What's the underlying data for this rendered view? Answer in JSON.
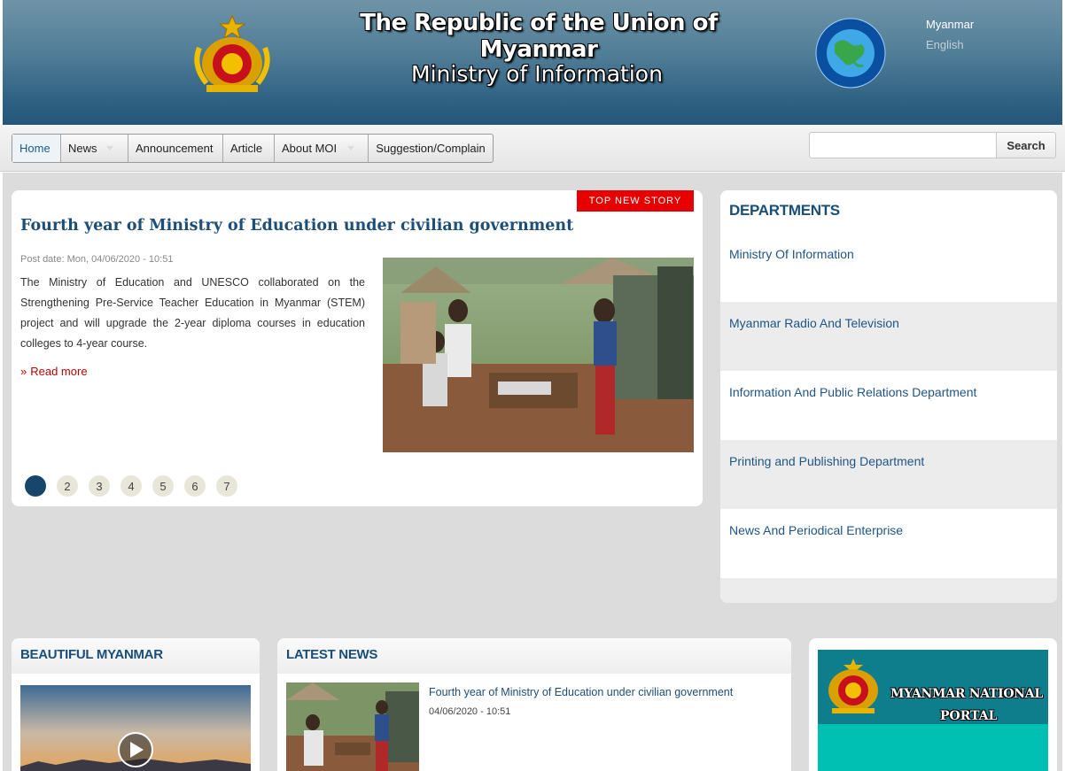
{
  "header": {
    "title_line1": "The Republic of the Union of Myanmar",
    "title_line2": "Ministry of Information",
    "languages": [
      "Myanmar",
      "English"
    ]
  },
  "nav": {
    "items": [
      {
        "label": "Home",
        "active": true,
        "has_dropdown": false
      },
      {
        "label": "News",
        "active": false,
        "has_dropdown": true
      },
      {
        "label": "Announcement",
        "active": false,
        "has_dropdown": false
      },
      {
        "label": "Article",
        "active": false,
        "has_dropdown": false
      },
      {
        "label": "About MOI",
        "active": false,
        "has_dropdown": true
      },
      {
        "label": "Suggestion/Complain",
        "active": false,
        "has_dropdown": false
      }
    ],
    "search": {
      "value": "",
      "button_label": "Search"
    }
  },
  "top_story": {
    "badge": "TOP NEW STORY",
    "title": "Fourth year of Ministry of Education under civilian government",
    "post_date": "Post date: Mon, 04/06/2020 - 10:51",
    "body": "The Ministry of Education and UNESCO collaborated on the Strengthening Pre-Service Teacher Education in Myanmar (STEM) project and will upgrade the 2-year diploma courses in education colleges to 4-year course.",
    "read_more": "Read more",
    "pager": {
      "active": 1,
      "pages": [
        "",
        "2",
        "3",
        "4",
        "5",
        "6",
        "7"
      ]
    }
  },
  "departments": {
    "title": "DEPARTMENTS",
    "items": [
      "Ministry Of Information",
      "Myanmar Radio And Television",
      "Information And Public Relations Department",
      "Printing and Publishing Department",
      "News And Periodical Enterprise"
    ]
  },
  "beautiful_myanmar": {
    "title": "BEAUTIFUL MYANMAR"
  },
  "latest_news": {
    "title": "LATEST NEWS",
    "items": [
      {
        "headline": "Fourth year of Ministry of Education under civilian government",
        "date": "04/06/2020 - 10:51"
      }
    ]
  },
  "portal": {
    "line1": "MYANMAR NATIONAL",
    "line2": "PORTAL"
  },
  "colors": {
    "accent": "#1d4e78",
    "badge": "#e60000",
    "read_more": "#c00000",
    "portal_bg": "#00c0b4"
  }
}
